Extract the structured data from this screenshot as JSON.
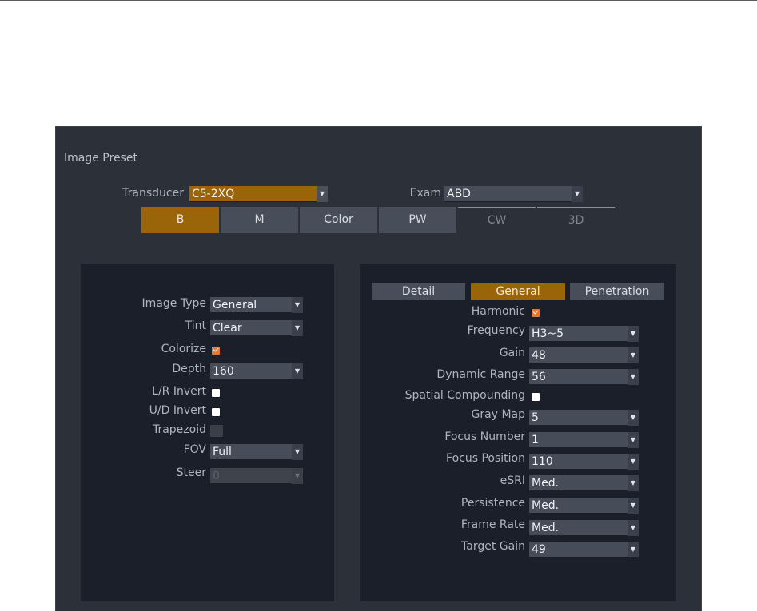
{
  "window": {
    "title": "Image Preset"
  },
  "transducer": {
    "label": "Transducer",
    "value": "C5-2XQ"
  },
  "exam": {
    "label": "Exam",
    "value": "ABD"
  },
  "mode_tabs": [
    {
      "label": "B",
      "state": "active"
    },
    {
      "label": "M",
      "state": "normal"
    },
    {
      "label": "Color",
      "state": "normal"
    },
    {
      "label": "PW",
      "state": "normal"
    },
    {
      "label": "CW",
      "state": "flat"
    },
    {
      "label": "3D",
      "state": "flat"
    }
  ],
  "left_panel": {
    "image_type": {
      "label": "Image Type",
      "value": "General"
    },
    "tint": {
      "label": "Tint",
      "value": "Clear"
    },
    "colorize": {
      "label": "Colorize",
      "checked": true
    },
    "depth": {
      "label": "Depth",
      "value": "160"
    },
    "lr_invert": {
      "label": "L/R Invert",
      "checked": false
    },
    "ud_invert": {
      "label": "U/D Invert",
      "checked": false
    },
    "trapezoid": {
      "label": "Trapezoid",
      "disabled": true
    },
    "fov": {
      "label": "FOV",
      "value": "Full"
    },
    "steer": {
      "label": "Steer",
      "value": "0",
      "disabled": true
    }
  },
  "right_panel": {
    "tabs": [
      {
        "label": "Detail",
        "active": false
      },
      {
        "label": "General",
        "active": true
      },
      {
        "label": "Penetration",
        "active": false
      }
    ],
    "harmonic": {
      "label": "Harmonic",
      "checked": true
    },
    "frequency": {
      "label": "Frequency",
      "value": "H3~5"
    },
    "gain": {
      "label": "Gain",
      "value": "48"
    },
    "dynamic_range": {
      "label": "Dynamic Range",
      "value": "56"
    },
    "spatial_compounding": {
      "label": "Spatial Compounding",
      "checked": false
    },
    "gray_map": {
      "label": "Gray Map",
      "value": "5"
    },
    "focus_number": {
      "label": "Focus Number",
      "value": "1"
    },
    "focus_position": {
      "label": "Focus Position",
      "value": "110"
    },
    "esri": {
      "label": "eSRI",
      "value": "Med."
    },
    "persistence": {
      "label": "Persistence",
      "value": "Med."
    },
    "frame_rate": {
      "label": "Frame Rate",
      "value": "Med."
    },
    "target_gain": {
      "label": "Target Gain",
      "value": "49"
    }
  },
  "colors": {
    "accent": "#9a6508",
    "panel": "#1b1f29",
    "window": "#2b3039",
    "checkbox_on": "#e8792c"
  },
  "icons": {
    "dropdown": "triangle-down",
    "check": "checkmark"
  }
}
